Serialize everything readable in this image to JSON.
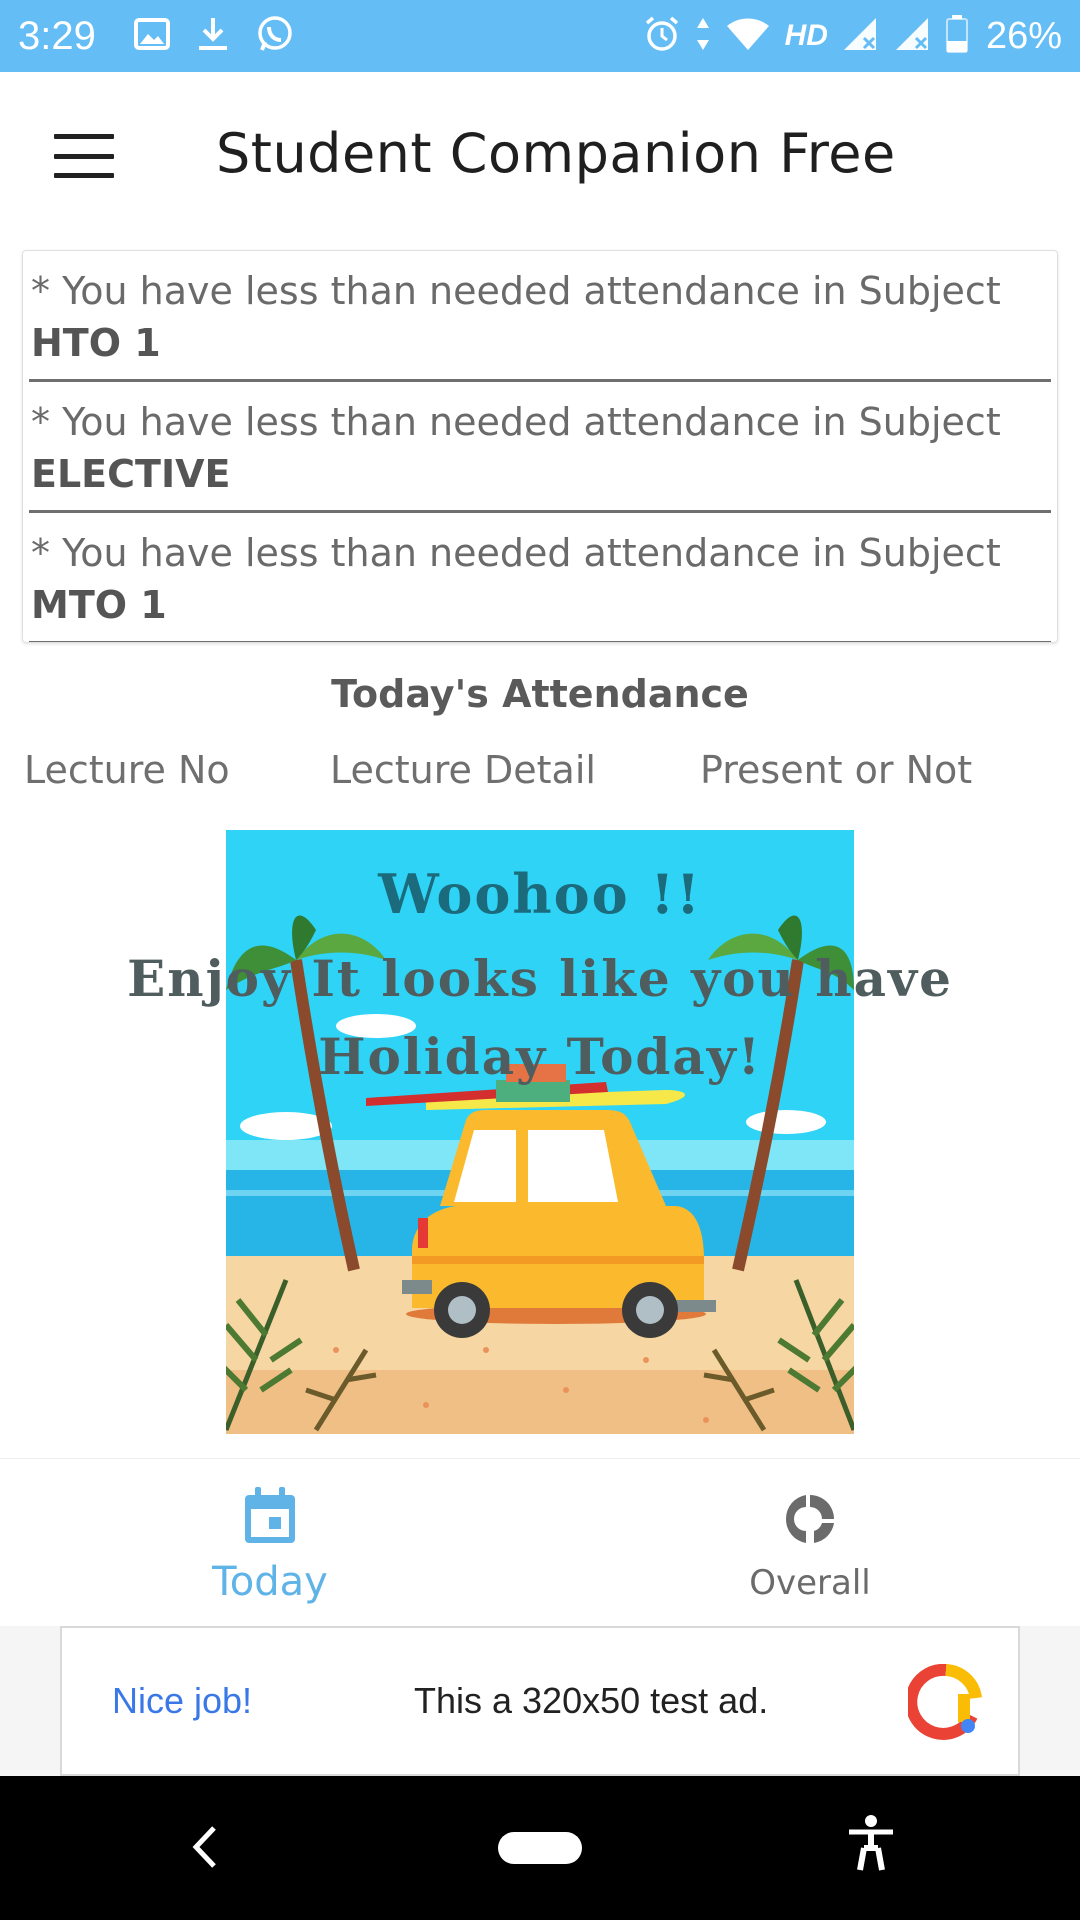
{
  "status_bar": {
    "time": "3:29",
    "network": "HD",
    "battery": "26%",
    "left_icons": [
      "image-icon",
      "download-icon",
      "whatsapp-icon"
    ],
    "right_icons": [
      "alarm-icon",
      "data-arrows-icon",
      "wifi-icon",
      "signal-icon",
      "signal-icon",
      "battery-icon"
    ]
  },
  "app_bar": {
    "title": "Student Companion Free"
  },
  "warnings": {
    "prefix": "* You have less than needed attendance in Subject ",
    "items": [
      {
        "subject": "HTO 1"
      },
      {
        "subject": "ELECTIVE"
      },
      {
        "subject": "MTO 1"
      },
      {
        "subject": ""
      }
    ]
  },
  "attendance": {
    "title": "Today's Attendance",
    "columns": [
      "Lecture No",
      "Lecture Detail",
      "Present or Not"
    ]
  },
  "holiday": {
    "line1": "Woohoo !!",
    "line2": "Enjoy It looks like you have",
    "line3": "Holiday Today!"
  },
  "bottom_nav": {
    "items": [
      {
        "label": "Today",
        "icon": "calendar-icon",
        "active": true
      },
      {
        "label": "Overall",
        "icon": "donut-chart-icon",
        "active": false
      }
    ]
  },
  "ad": {
    "badge": "Nice job!",
    "text": "This a 320x50 test ad."
  },
  "colors": {
    "status_bar": "#64bdf5",
    "active_tab": "#5fb3e6",
    "sky": "#2ed3f6",
    "sea": "#27b4e6",
    "sand": "#f6d6a2",
    "car": "#fbb92d"
  }
}
